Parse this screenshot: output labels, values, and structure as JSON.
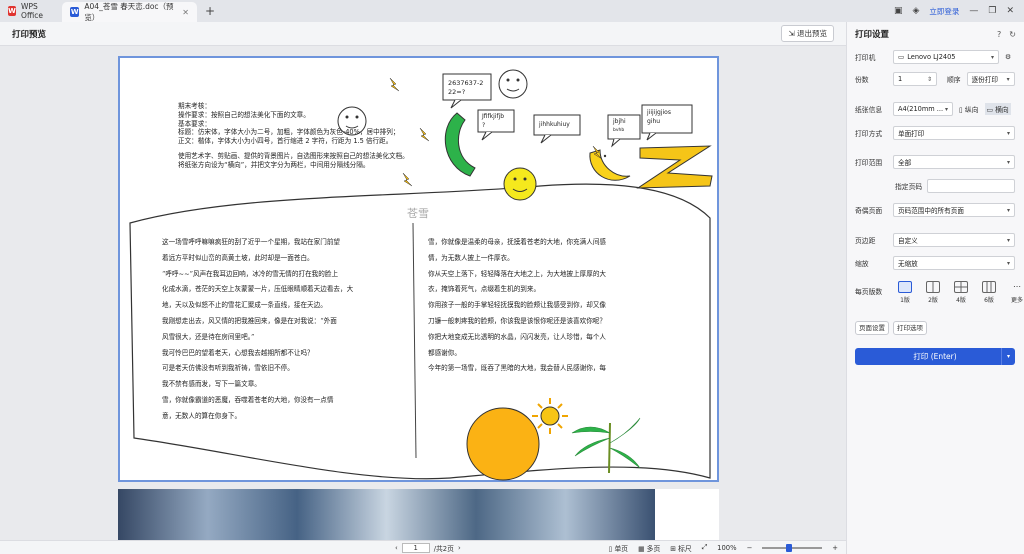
{
  "tabs": {
    "app": "WPS Office",
    "doc": "A04_苍雪 春天恋.doc（预览）"
  },
  "window": {
    "login": "立即登录"
  },
  "toolbar": {
    "title": "打印预览",
    "exit": "退出预览"
  },
  "doc": {
    "instructions": [
      "期末考核：",
      "操作要求：按照自己的想法美化下面的文章。",
      "基本要求：",
      "标题：仿宋体，字体大小为二号，加粗，字体颜色为灰色-40%，居中排列；",
      "正文：楷体，字体大小为小四号，首行缩进 2 字符，行距为 1.5 倍行距。",
      "使用艺术字、剪贴画、提供的背景图片，自选图形来按照自己的想法美化文档。",
      "将纸张方向设为“横向”，并把文字分为两栏，中间用分隔线分隔。"
    ],
    "bubbles": {
      "b1": "2637637-2",
      "b1b": "22=?",
      "b2": "Jfifkjifjb",
      "b2b": "?",
      "b3": "jihhkuhiuy",
      "b4": "jbjhi",
      "b4b": "bvhb",
      "b5": "jiijijgjios",
      "b5b": "gihu"
    },
    "title": "苍雪",
    "left": [
      "这一场雪呼呼嘛嘛疯狂的刮了近乎一个星期，我站在家门前望",
      "着远方平时似山峦的高黄土坡，此时却是一面苍白。",
      "“呼呼~~”风声在我耳边回响，冰冷的雪无情的打在我的脸上",
      "化成水滴，苍茫的天空上灰蒙蒙一片，压低眼睛顺着天边看去，大",
      "地，天以及似怒不止的雪花汇聚成一条直线，接在天边。",
      "我刚想走出去，风又情的把我推回来，像是在对我说：“外面",
      "风雪很大，还是待在房间里吧。”",
      "我可怜巴巴的望着老天，心想我去越期所都不让吗？",
      "可是老天仿佛没有听到我祈祷，雪依旧不停。",
      "我不禁有感而发，写下一篇文章。",
      "雪，你就像霸道的恶魔，吞噬着苍老的大地，你没有一点情",
      "意，无数人的算在你身下。"
    ],
    "right": [
      "雪，你就像是温柔的母亲，抚摸着苍老的大地，你充满人间感",
      "情，为无数人披上一件厚衣。",
      "你从天空上落下，轻轻降落在大地之上，为大地披上厚厚的大",
      "衣，掩饰着死气，点缀着生机的到来。",
      "你用孩子一般的手掌轻轻抚摸我的脸颊让我感受到你，却又像",
      "刀镰一般刺疼我的脸颊，你该我是该恨你呢还是该喜欢你呢？",
      "你把大地变成无比透明的水晶，闪闪发亮，让人珍惜，每个人",
      "都感谢你。",
      "今年的第一场雪，既吞了黑暗的大地，我会替人民感谢你，每"
    ]
  },
  "status": {
    "page": "1",
    "total": "/共2页",
    "single": "单页",
    "multi": "多页",
    "ruler": "标尺",
    "zoom": "100%"
  },
  "panel": {
    "title": "打印设置",
    "printer_label": "打印机",
    "printer": "Lenovo LJ2405",
    "copies_label": "份数",
    "copies": "1",
    "order_label": "顺序",
    "order": "逐份打印",
    "paper_label": "纸张信息",
    "paper": "A4(210mm ...",
    "portrait": "纵向",
    "landscape": "横向",
    "mode_label": "打印方式",
    "mode": "单面打印",
    "range_label": "打印范围",
    "range": "全部",
    "pages_label": "指定页码",
    "oddeven_label": "奇偶页面",
    "oddeven": "页码范围中的所有页面",
    "margin_label": "页边距",
    "margin": "自定义",
    "scale_label": "缩放",
    "scale": "无缩放",
    "pps_label": "每页版数",
    "layouts": [
      "1版",
      "2版",
      "4版",
      "6版",
      "更多"
    ],
    "setup": "页面设置",
    "options": "打印选项",
    "print": "打印 (Enter)"
  }
}
